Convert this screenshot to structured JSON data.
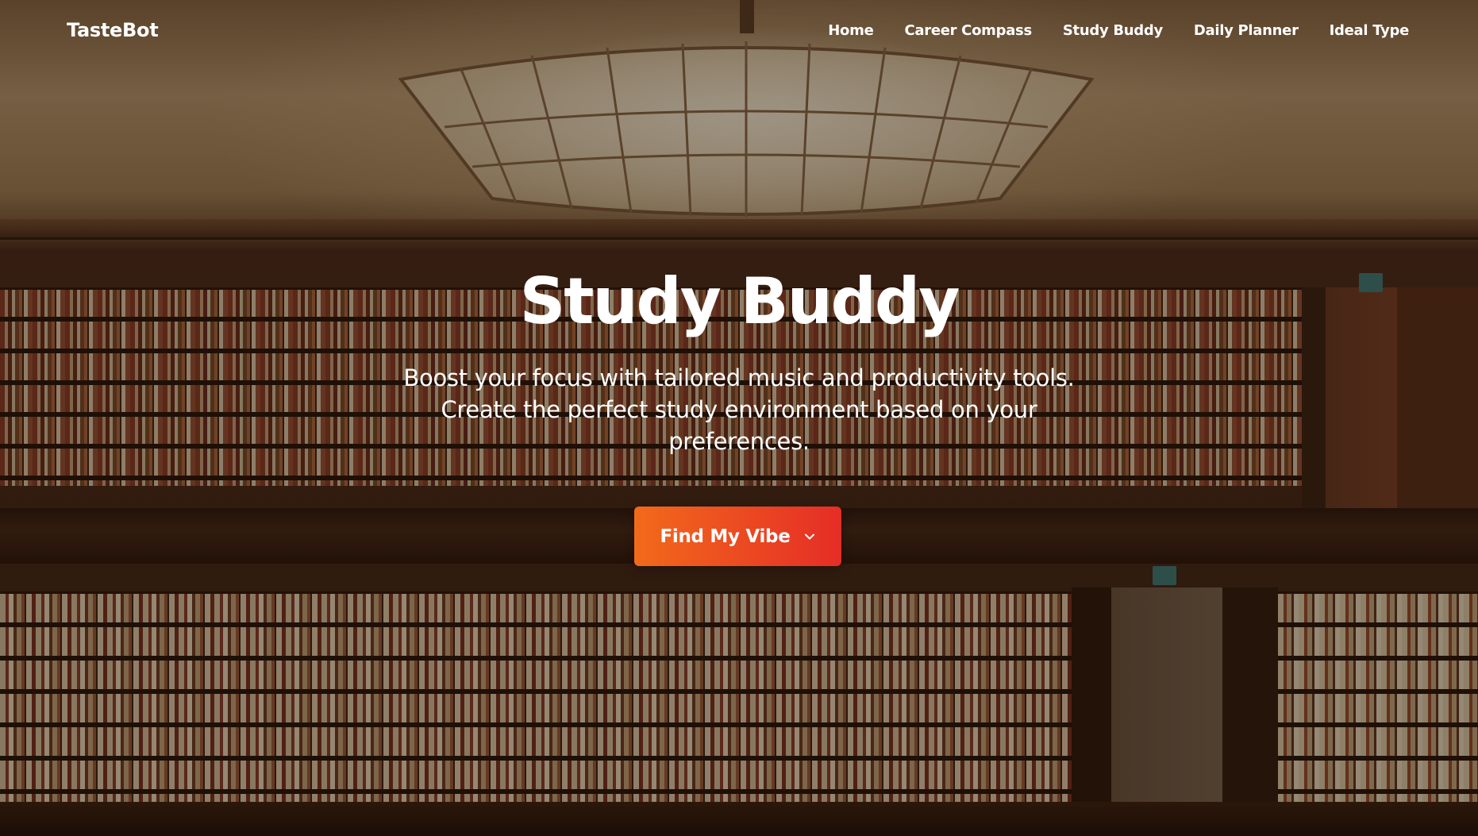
{
  "brand": {
    "name": "TasteBot"
  },
  "nav": {
    "links": [
      {
        "label": "Home"
      },
      {
        "label": "Career Compass"
      },
      {
        "label": "Study Buddy"
      },
      {
        "label": "Daily Planner"
      },
      {
        "label": "Ideal Type"
      }
    ]
  },
  "hero": {
    "title": "Study Buddy",
    "subtitle": "Boost your focus with tailored music and productivity tools. Create the perfect study environment based on your preferences.",
    "cta_label": "Find My Vibe",
    "cta_icon": "chevron-down-icon",
    "background": "library-photo"
  },
  "colors": {
    "cta_start": "#f26a1b",
    "cta_end": "#e52d27",
    "text": "#ffffff"
  }
}
